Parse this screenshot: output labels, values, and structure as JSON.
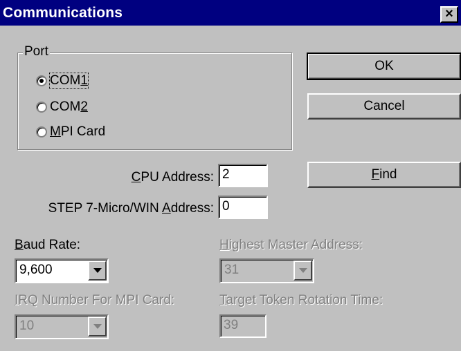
{
  "window": {
    "title": "Communications",
    "close_glyph": "×"
  },
  "port_group": {
    "label": "Port",
    "options": [
      {
        "pre": "",
        "accel": "",
        "post": "COM",
        "post_accel": "1",
        "checked": true
      },
      {
        "pre": "",
        "accel": "",
        "post": "COM",
        "post_accel": "2",
        "checked": false
      },
      {
        "pre": "",
        "accel": "M",
        "post": "PI Card",
        "post_accel": "",
        "checked": false
      }
    ]
  },
  "buttons": {
    "ok": "OK",
    "cancel": "Cancel",
    "find_accel": "F",
    "find_rest": "ind"
  },
  "cpu_address": {
    "accel": "C",
    "rest": "PU Address:",
    "value": "2"
  },
  "step7_address": {
    "pre": "STEP 7-Micro/WIN ",
    "accel": "A",
    "rest": "ddress:",
    "value": "0"
  },
  "baud_rate": {
    "accel": "B",
    "rest": "aud Rate:",
    "value": "9,600"
  },
  "highest_master": {
    "accel": "H",
    "rest": "ighest Master Address:",
    "value": "31"
  },
  "irq_number": {
    "accel": "I",
    "rest": "RQ Number For MPI Card:",
    "value": "10"
  },
  "target_token": {
    "accel": "T",
    "rest": "arget Token Rotation Time:",
    "value": "39"
  },
  "icons": {
    "close": "close-icon",
    "dropdown": "chevron-down-icon"
  }
}
